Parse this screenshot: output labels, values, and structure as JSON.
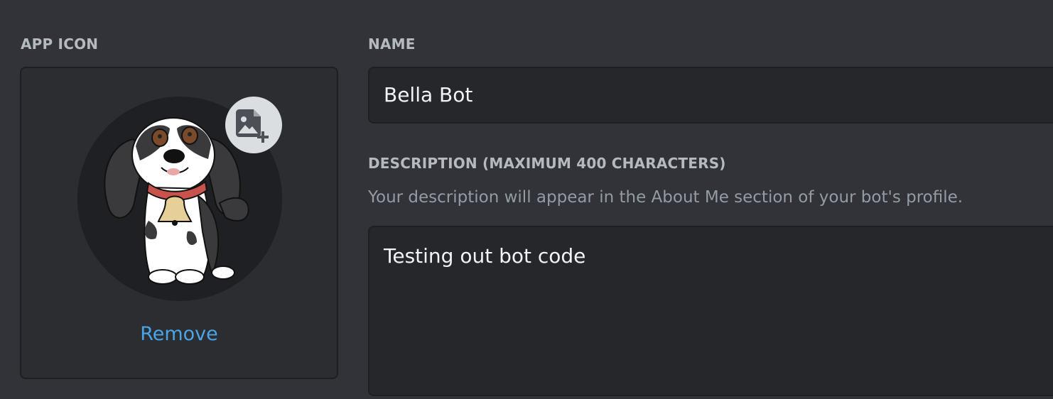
{
  "app_icon": {
    "label": "APP ICON",
    "remove_label": "Remove",
    "avatar_icon": "dog-avatar-image",
    "upload_icon": "image-add-icon"
  },
  "name": {
    "label": "NAME",
    "value": "Bella Bot"
  },
  "description": {
    "label": "DESCRIPTION (MAXIMUM 400 CHARACTERS)",
    "hint": "Your description will appear in the About Me section of your bot's profile.",
    "value": "Testing out bot code"
  },
  "colors": {
    "background": "#313338",
    "input_background": "#25272b",
    "link": "#4aa4e8",
    "label": "#b5bac1"
  }
}
